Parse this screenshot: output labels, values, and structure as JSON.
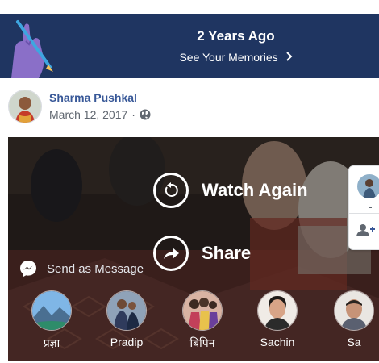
{
  "banner": {
    "title": "2 Years Ago",
    "cta": "See Your Memories"
  },
  "post": {
    "author": "Sharma Pushkal",
    "date": "March 12, 2017",
    "separator": "·",
    "privacy_icon": "globe-icon"
  },
  "video": {
    "watch_again": "Watch Again",
    "share": "Share",
    "send_as_message": "Send as Message"
  },
  "friends": [
    "प्रज्ञा",
    "Pradip",
    "बिपिन",
    "Sachin",
    "Sa"
  ],
  "colors": {
    "banner_bg": "#1f3561",
    "link": "#385898",
    "meta": "#606770"
  }
}
